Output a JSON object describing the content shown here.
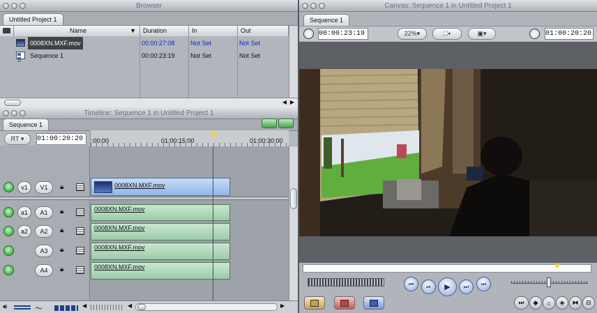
{
  "browser": {
    "title": "Browser",
    "tab": "Untitled Project 1",
    "columns": [
      "Name",
      "Duration",
      "In",
      "Out"
    ],
    "rows": [
      {
        "icon": "clip-icon",
        "name": "0008XN.MXF.mov",
        "duration": "00:00:27:08",
        "in": "Not Set",
        "out": "Not Set",
        "selected": true
      },
      {
        "icon": "sequence-icon",
        "name": "Sequence 1",
        "duration": "00:00:23:19",
        "in": "Not Set",
        "out": "Not Set",
        "selected": false
      }
    ]
  },
  "timeline": {
    "title": "Timeline: Sequence 1 in Untitled Project 1",
    "tab": "Sequence 1",
    "rt_label": "RT",
    "timecode": "01:00:20:20",
    "ruler": [
      ":00:00",
      "01:00:15:00",
      "01:00:30:00"
    ],
    "video_tracks": [
      {
        "source": "v1",
        "dest": "V1",
        "clip": "0008XN.MXF.mov"
      }
    ],
    "audio_tracks": [
      {
        "source": "a1",
        "dest": "A1",
        "clip": "0008XN.MXF.mov"
      },
      {
        "source": "a2",
        "dest": "A2",
        "clip": "0008XN.MXF.mov"
      },
      {
        "source": "",
        "dest": "A3",
        "clip": "0008XN.MXF.mov"
      },
      {
        "source": "",
        "dest": "A4",
        "clip": "0008XN.MXF.mov"
      }
    ]
  },
  "canvas": {
    "title": "Canvas: Sequence 1 in Untitled Project 1",
    "tab": "Sequence 1",
    "duration": "00:00:23:19",
    "zoom": "22%",
    "current_timecode": "01:00:20:20"
  },
  "colors": {
    "selected_text": "#0d2bc8",
    "video_clip": "#a9c6ee",
    "audio_clip": "#afd6b9",
    "playhead": "#f5d21f"
  }
}
